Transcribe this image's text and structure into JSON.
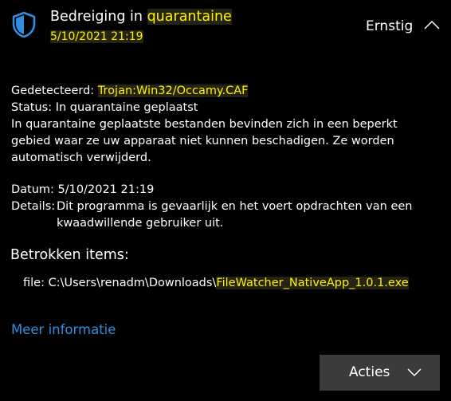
{
  "header": {
    "title_prefix": "Bedreiging in ",
    "title_highlight": "quarantaine",
    "datetime": "5/10/2021 21:19",
    "severity": "Ernstig",
    "icon": "shield-icon"
  },
  "details": {
    "detected_label": "Gedetecteerd:",
    "detected_value": "Trojan:Win32/Occamy.CAF",
    "status_label": "Status:",
    "status_value": "In quarantaine geplaatst",
    "description": "In quarantaine geplaatste bestanden bevinden zich in een beperkt gebied waar ze uw apparaat niet kunnen beschadigen. Ze worden automatisch verwijderd.",
    "date_label": "Datum:",
    "date_value": "5/10/2021 21:19",
    "details_label": "Details:",
    "details_value": "Dit programma is gevaarlijk en het voert opdrachten van een kwaadwillende gebruiker uit."
  },
  "affected_items": {
    "title": "Betrokken items:",
    "file_prefix": "file: C:\\Users\\renadm\\Downloads\\",
    "file_highlight": "FileWatcher_NativeApp_1.0.1.exe"
  },
  "links": {
    "more_info": "Meer informatie"
  },
  "actions": {
    "button_label": "Acties",
    "chevron": "chevron-down-icon"
  },
  "colors": {
    "background": "#000000",
    "text": "#ffffff",
    "highlight_text": "#fff200",
    "link": "#2e8ee0",
    "button_bg": "#3b3b3b",
    "shield": "#2e8ee0"
  }
}
